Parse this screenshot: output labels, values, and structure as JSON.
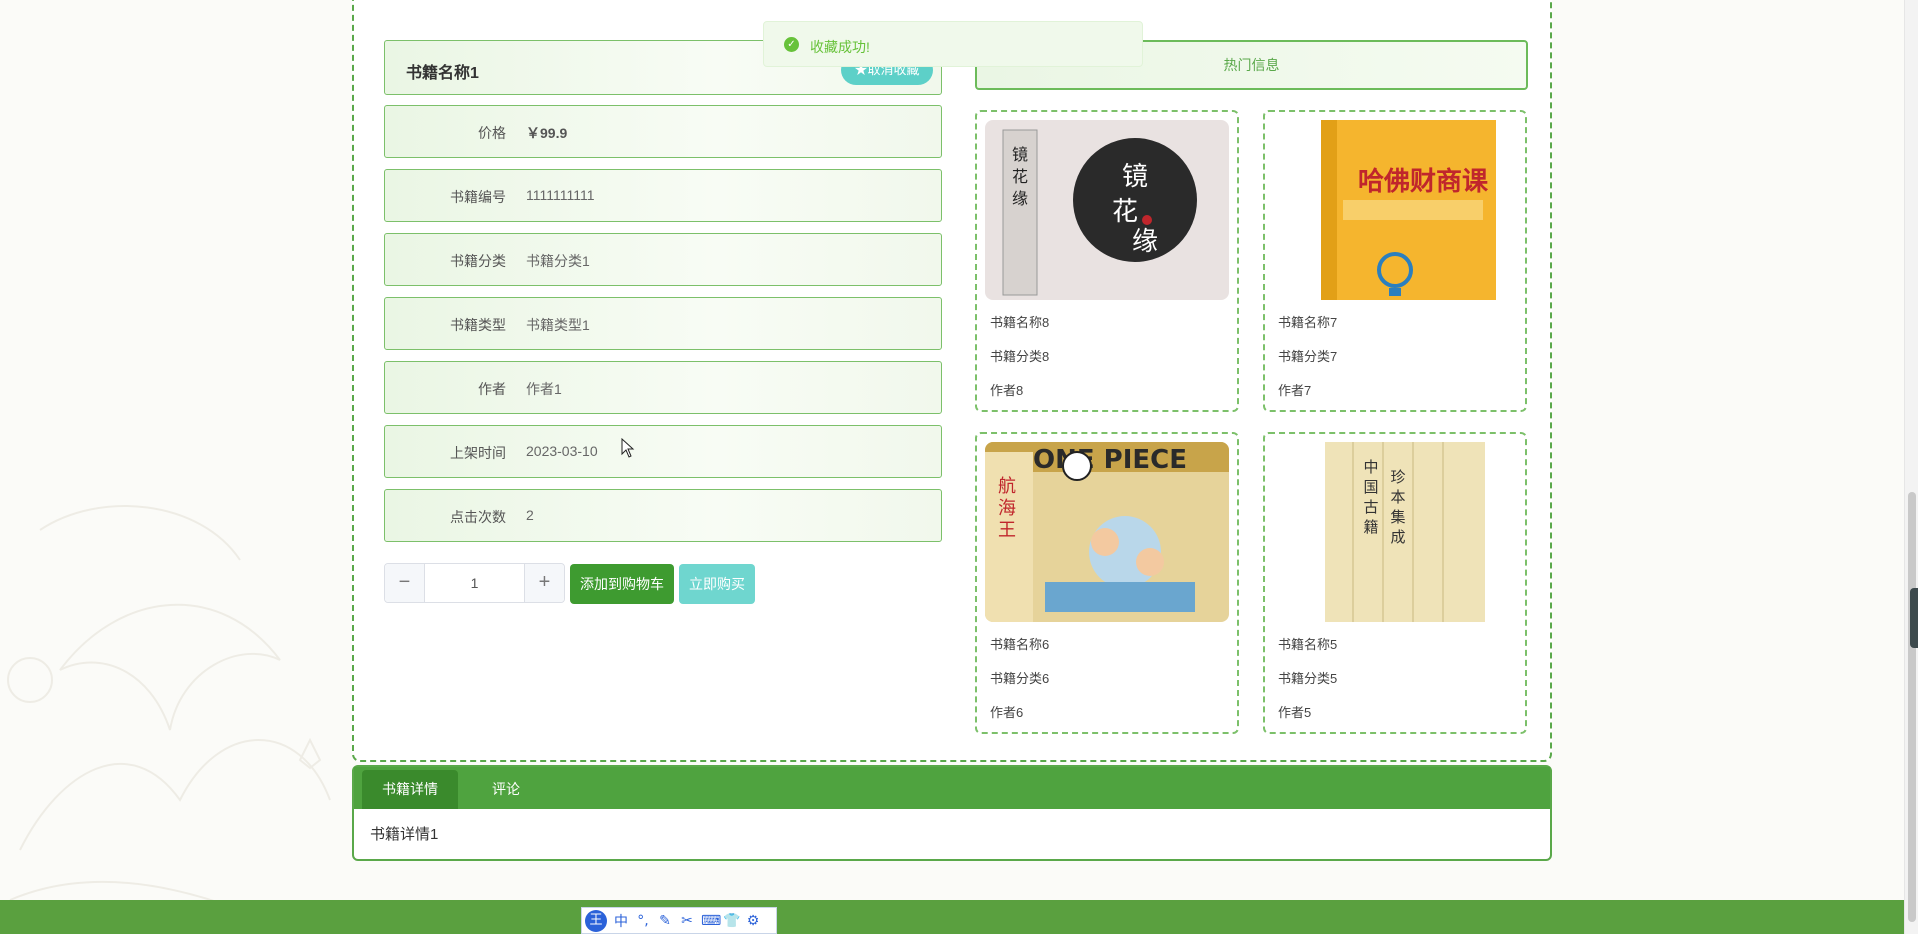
{
  "toast": {
    "message": "收藏成功!",
    "icon": "check-circle-icon"
  },
  "book": {
    "title": "书籍名称1",
    "favorite_button": "★取消收藏",
    "fields": [
      {
        "label": "价格",
        "value": "￥99.9"
      },
      {
        "label": "书籍编号",
        "value": "1111111111"
      },
      {
        "label": "书籍分类",
        "value": "书籍分类1"
      },
      {
        "label": "书籍类型",
        "value": "书籍类型1"
      },
      {
        "label": "作者",
        "value": "作者1"
      },
      {
        "label": "上架时间",
        "value": "2023-03-10"
      },
      {
        "label": "点击次数",
        "value": "2"
      }
    ]
  },
  "quantity": {
    "minus": "−",
    "value": "1",
    "plus": "+"
  },
  "actions": {
    "add_to_cart": "添加到购物车",
    "buy_now": "立即购买"
  },
  "hot": {
    "title": "热门信息",
    "items": [
      {
        "name": "书籍名称8",
        "category": "书籍分类8",
        "author": "作者8",
        "cover_text": "镜花缘"
      },
      {
        "name": "书籍名称7",
        "category": "书籍分类7",
        "author": "作者7",
        "cover_text": "哈佛财商课"
      },
      {
        "name": "书籍名称6",
        "category": "书籍分类6",
        "author": "作者6",
        "cover_text": "ONE PIECE"
      },
      {
        "name": "书籍名称5",
        "category": "书籍分类5",
        "author": "作者5",
        "cover_text": "中国古籍珍本集成"
      }
    ]
  },
  "tabs": {
    "items": [
      {
        "label": "书籍详情"
      },
      {
        "label": "评论"
      }
    ],
    "content": "书籍详情1"
  },
  "ime": {
    "logo": "王",
    "items": [
      "中",
      "°,",
      "✎",
      "✂",
      "⌨",
      "👕",
      "⚙"
    ]
  },
  "colors": {
    "primary_green": "#4fa33f",
    "dark_green": "#3e9b30",
    "teal": "#5dd0c8",
    "success": "#67c23a"
  }
}
